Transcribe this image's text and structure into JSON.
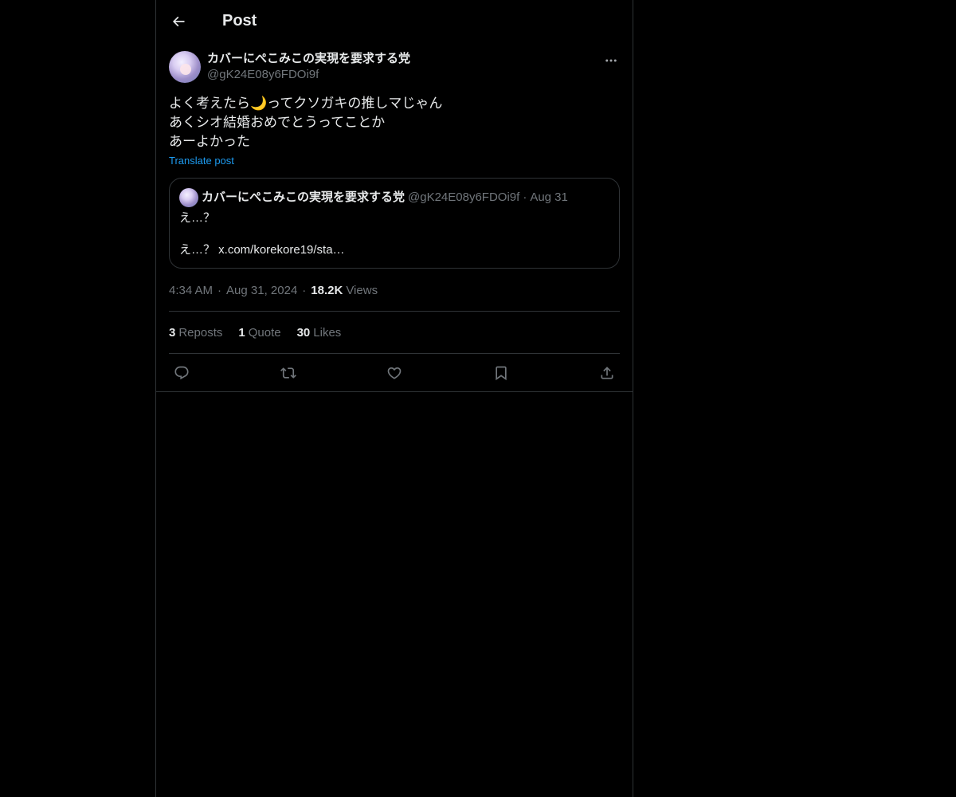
{
  "header": {
    "title": "Post",
    "back_icon": "arrow-left-icon"
  },
  "post": {
    "author": {
      "display_name": "カバーにぺこみこの実現を要求する党",
      "handle": "@gK24E08y6FDOi9f"
    },
    "text_lines": [
      "よく考えたら🌙ってクソガキの推しマじゃん",
      "あくシオ結婚おめでとうってことか",
      "あーよかった"
    ],
    "translate_label": "Translate post",
    "quote": {
      "display_name": "カバーにぺこみこの実現を要求する党",
      "handle": "@gK24E08y6FDOi9f",
      "separator": "·",
      "date": "Aug 31",
      "line1": "え…？",
      "line2": "え…？ x.com/korekore19/sta…"
    },
    "meta": {
      "time": "4:34 AM",
      "date": "Aug 31, 2024",
      "separator": "·",
      "views_count": "18.2K",
      "views_label": "Views"
    },
    "stats": {
      "reposts_count": "3",
      "reposts_label": "Reposts",
      "quotes_count": "1",
      "quotes_label": "Quote",
      "likes_count": "30",
      "likes_label": "Likes"
    },
    "actions": [
      "reply-icon",
      "repost-icon",
      "like-icon",
      "bookmark-icon",
      "share-icon"
    ]
  },
  "colors": {
    "background": "#000000",
    "text": "#e7e9ea",
    "secondary": "#71767b",
    "accent": "#1d9bf0",
    "border": "#2f3336"
  }
}
